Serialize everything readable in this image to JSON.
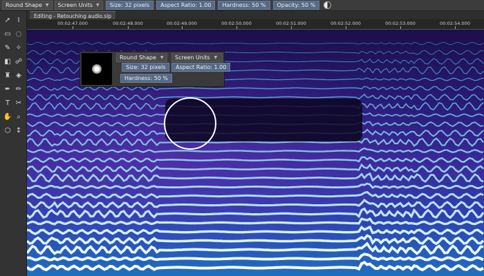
{
  "toolbar": {
    "brush_shape": "Round Shape",
    "units": "Screen Units",
    "size": "Size: 32 pixels",
    "aspect_ratio": "Aspect Ratio: 1.00",
    "hardness": "Hardness: 50 %",
    "opacity": "Opacity: 50 %"
  },
  "tab": {
    "title": "Editing - Retouching audio.slp"
  },
  "ruler": {
    "ticks": [
      "00:02:47.000",
      "00:02:48.000",
      "00:02:49.000",
      "00:02:50.000",
      "00:02:51.000",
      "00:02:52.000",
      "00:02:53.000",
      "00:02:54.000"
    ]
  },
  "brush_panel": {
    "shape": "Round Shape",
    "units": "Screen Units",
    "size": "Size: 32 pixels",
    "aspect_ratio": "Aspect Ratio: 1.00",
    "hardness": "Hardness: 50 %"
  },
  "colors": {
    "accent": "#566a86",
    "spectrogram_low": "#1c0f4a",
    "spectrogram_high": "#33e6ff"
  },
  "icons": [
    "select-arrow-icon",
    "text-cursor-icon",
    "rect-select-icon",
    "lasso-icon",
    "brush-icon",
    "wand-icon",
    "eraser-icon",
    "smudge-icon",
    "clone-stamp-icon",
    "fill-icon",
    "pen-icon",
    "pencil-icon",
    "type-tool-icon",
    "scissors-icon",
    "hand-icon",
    "zoom-icon",
    "cube-icon",
    "time-select-icon"
  ]
}
